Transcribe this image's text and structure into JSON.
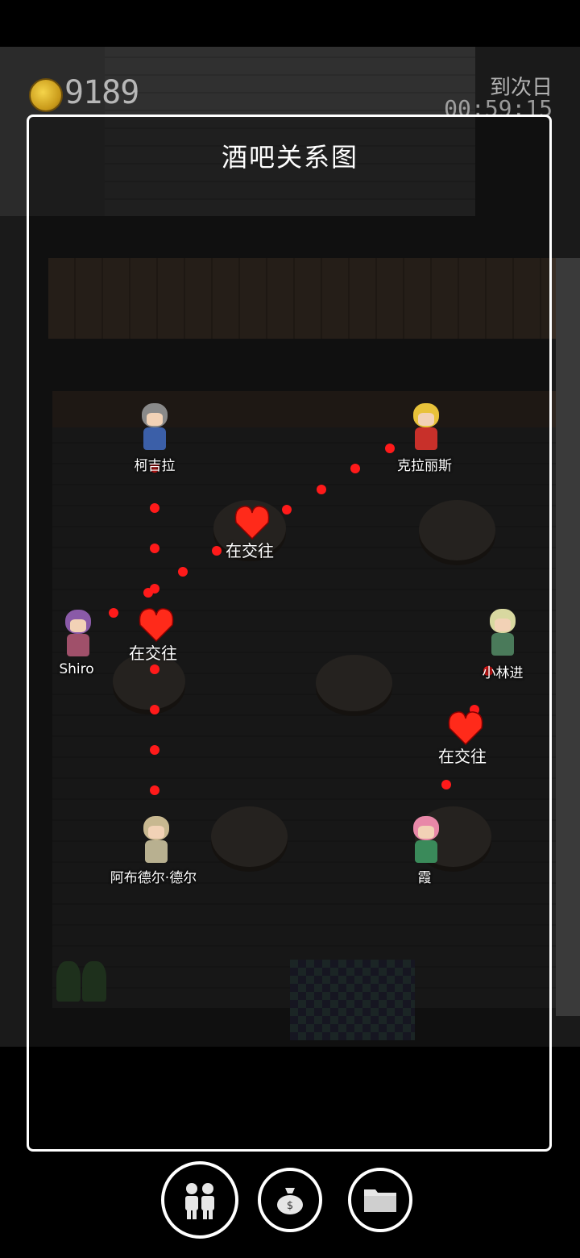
{
  "hud": {
    "gold": "9189",
    "timer_label": "到次日",
    "timer_value": "00:59:15"
  },
  "panel": {
    "title": "酒吧关系图"
  },
  "characters": [
    {
      "name": "柯吉拉",
      "hair": "#8a8a8a",
      "body": "#3b5fa8"
    },
    {
      "name": "克拉丽斯",
      "hair": "#e8c23a",
      "body": "#c8302a"
    },
    {
      "name": "Shiro",
      "hair": "#8a5aa8",
      "body": "#a0506a"
    },
    {
      "name": "小林进",
      "hair": "#d8d8a0",
      "body": "#4a7a5a"
    },
    {
      "name": "阿布德尔·德尔",
      "hair": "#c8b890",
      "body": "#b8b090"
    },
    {
      "name": "霞",
      "hair": "#e888a8",
      "body": "#3a8a5a"
    }
  ],
  "relations": [
    {
      "from": "柯吉拉",
      "to": "克拉丽斯",
      "status": "在交往"
    },
    {
      "from": "Shiro",
      "to": "阿布德尔·德尔",
      "status": "在交往"
    },
    {
      "from": "小林进",
      "to": "霞",
      "status": "在交往"
    }
  ],
  "colors": {
    "link": "#ff1a1a",
    "heart": "#ff2a1a",
    "panel_border": "#ffffff"
  },
  "nav": [
    {
      "icon": "people-icon"
    },
    {
      "icon": "money-bag-icon"
    },
    {
      "icon": "folder-icon"
    }
  ]
}
